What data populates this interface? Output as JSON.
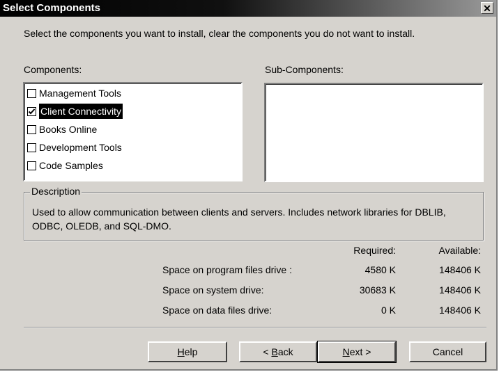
{
  "window": {
    "title": "Select Components",
    "close_symbol": "✕"
  },
  "instruction": "Select the components you want to install, clear the components you do not want to install.",
  "components": {
    "label": "Components:",
    "items": [
      {
        "label": "Management Tools",
        "checked": false,
        "selected": false
      },
      {
        "label": "Client Connectivity",
        "checked": true,
        "selected": true
      },
      {
        "label": "Books Online",
        "checked": false,
        "selected": false
      },
      {
        "label": "Development Tools",
        "checked": false,
        "selected": false
      },
      {
        "label": "Code Samples",
        "checked": false,
        "selected": false
      }
    ]
  },
  "subcomponents": {
    "label": "Sub-Components:"
  },
  "description": {
    "legend": "Description",
    "text": "Used to allow communication between clients and servers. Includes network libraries for DBLIB, ODBC, OLEDB, and SQL-DMO."
  },
  "space": {
    "required_header": "Required:",
    "available_header": "Available:",
    "rows": [
      {
        "label": "Space on program files drive :",
        "required": "4580 K",
        "available": "148406 K"
      },
      {
        "label": "Space on system drive:",
        "required": "30683 K",
        "available": "148406 K"
      },
      {
        "label": "Space on data files drive:",
        "required": "0 K",
        "available": "148406 K"
      }
    ]
  },
  "buttons": {
    "help": {
      "pre": "",
      "key": "H",
      "post": "elp"
    },
    "back": {
      "pre": "< ",
      "key": "B",
      "post": "ack"
    },
    "next": {
      "pre": "",
      "key": "N",
      "post": "ext >"
    },
    "cancel": "Cancel"
  }
}
